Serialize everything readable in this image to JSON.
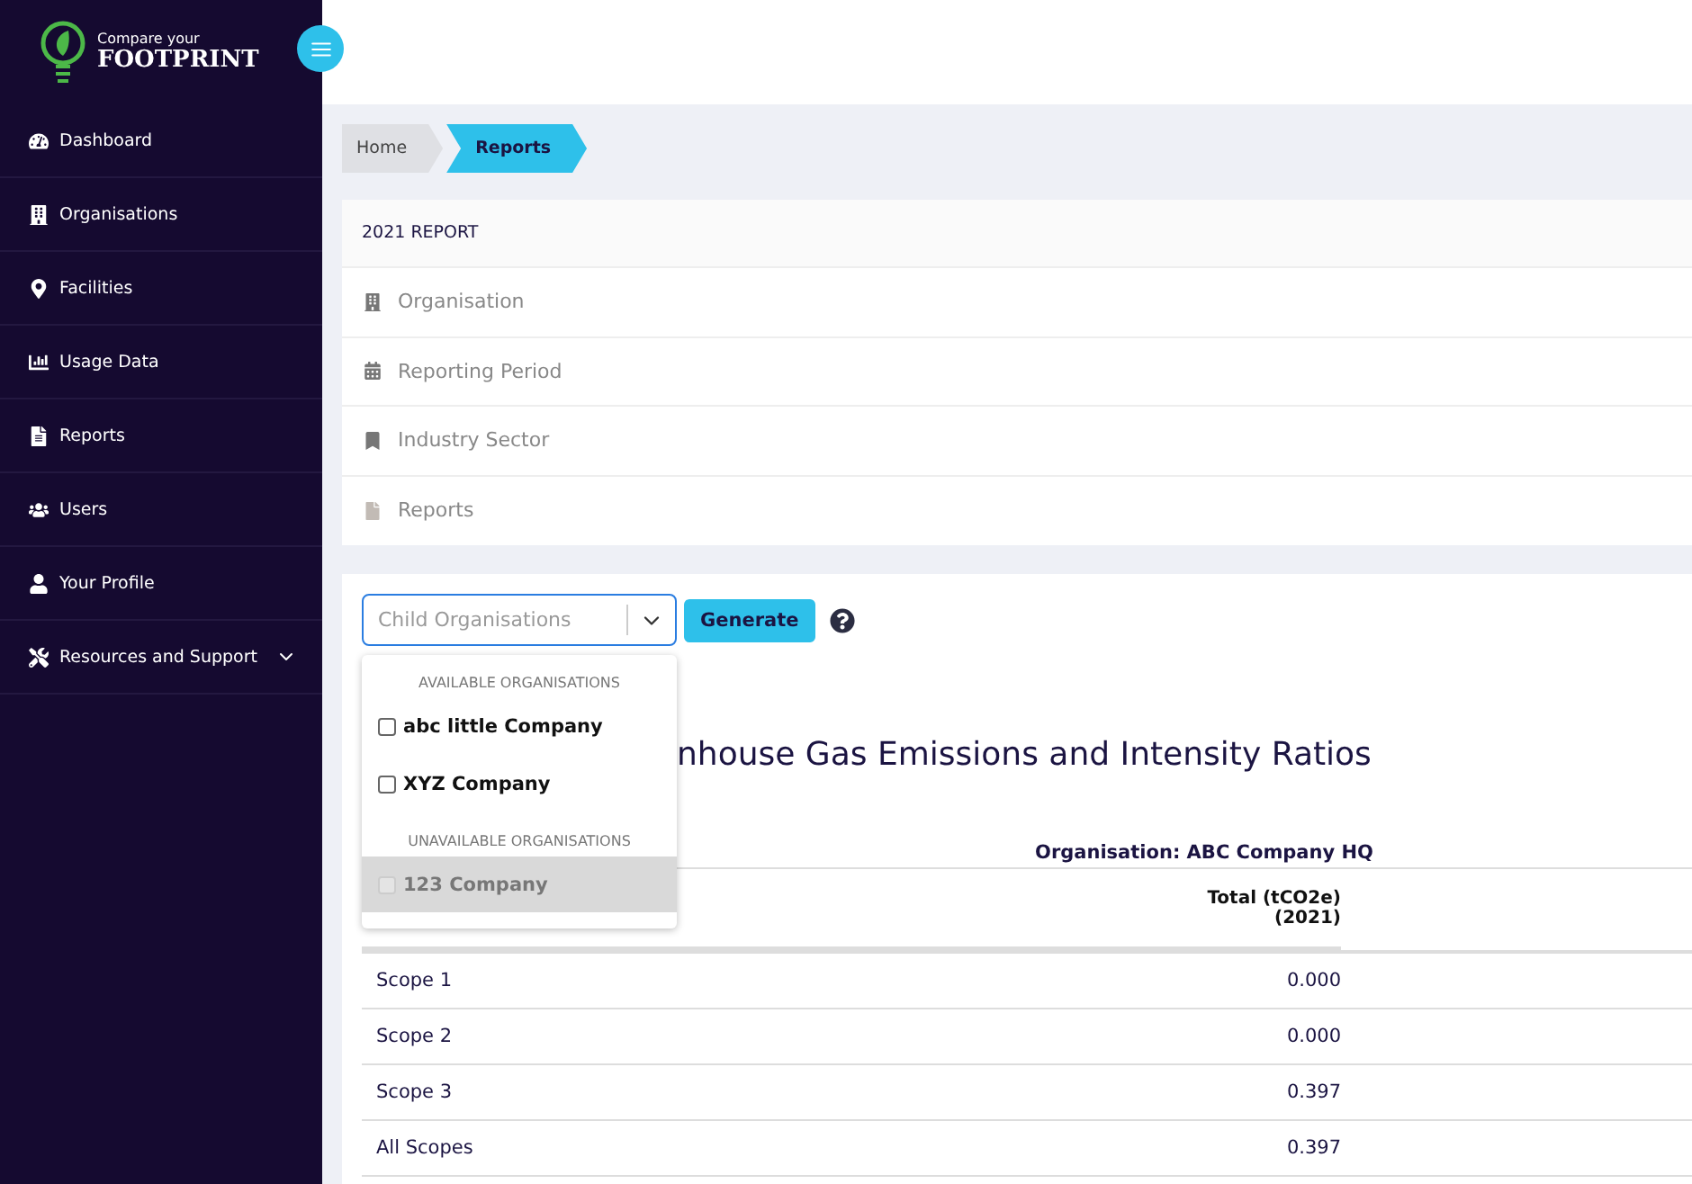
{
  "logo": {
    "line_1": "Compare your",
    "line_2": "FOOTPRINT"
  },
  "sidebar": {
    "items": [
      {
        "label": "Dashboard",
        "expandable": false
      },
      {
        "label": "Organisations",
        "expandable": false
      },
      {
        "label": "Facilities",
        "expandable": false
      },
      {
        "label": "Usage Data",
        "expandable": false
      },
      {
        "label": "Reports",
        "expandable": false
      },
      {
        "label": "Users",
        "expandable": false
      },
      {
        "label": "Your Profile",
        "expandable": false
      },
      {
        "label": "Resources and Support",
        "expandable": true
      }
    ]
  },
  "breadcrumb": [
    {
      "label": "Home",
      "selected": false
    },
    {
      "label": "Reports",
      "selected": true
    }
  ],
  "report_card": {
    "title": "2021 REPORT",
    "rows": [
      "Organisation",
      "Reporting Period",
      "Industry Sector",
      "Reports"
    ]
  },
  "select": {
    "placeholder": "Child Organisations",
    "open": true,
    "groups": [
      {
        "label": "AVAILABLE ORGANISATIONS",
        "options": [
          {
            "label": "abc little Company",
            "checked": false,
            "disabled": false
          },
          {
            "label": "XYZ Company",
            "checked": false,
            "disabled": false
          }
        ]
      },
      {
        "label": "UNAVAILABLE ORGANISATIONS",
        "options": [
          {
            "label": "123 Company",
            "checked": false,
            "disabled": true
          }
        ]
      }
    ]
  },
  "generate_button": "Generate",
  "heading": "nhouse Gas Emissions and Intensity Ratios",
  "table": {
    "organisation": "Organisation: ABC Company HQ",
    "total_header": [
      "Total (tCO2e)",
      "(2021)"
    ],
    "rows": [
      {
        "scope": "Scope 1",
        "total": "0.000"
      },
      {
        "scope": "Scope 2",
        "total": "0.000"
      },
      {
        "scope": "Scope 3",
        "total": "0.397"
      },
      {
        "scope": "All Scopes",
        "total": "0.397"
      }
    ]
  }
}
